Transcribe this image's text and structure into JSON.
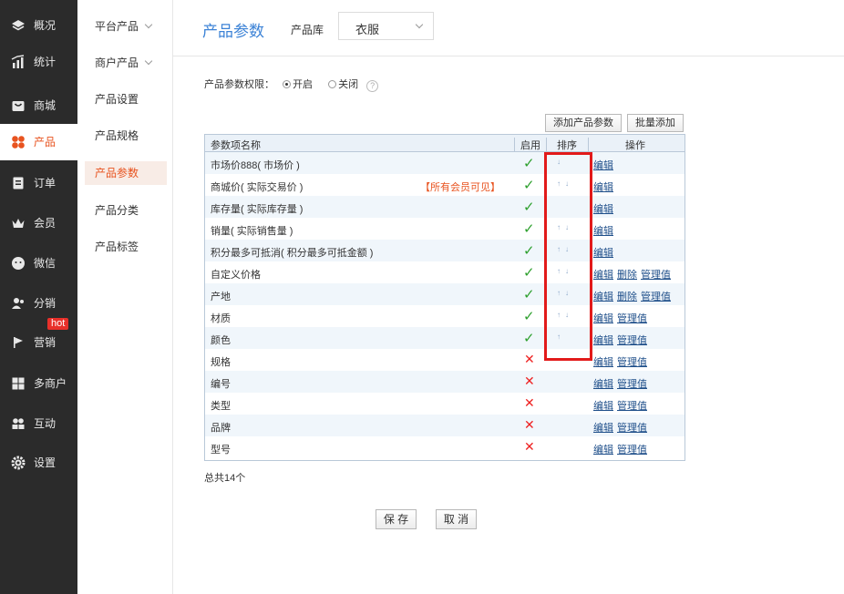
{
  "nav": {
    "items": [
      {
        "label": "概况",
        "icon": "layers-icon"
      },
      {
        "label": "统计",
        "icon": "chart-icon"
      },
      {
        "label": "商城",
        "icon": "shop-icon"
      },
      {
        "label": "产品",
        "icon": "product-icon"
      },
      {
        "label": "订单",
        "icon": "order-icon"
      },
      {
        "label": "会员",
        "icon": "crown-icon"
      },
      {
        "label": "微信",
        "icon": "wechat-icon"
      },
      {
        "label": "分销",
        "icon": "distribution-icon"
      },
      {
        "label": "营销",
        "icon": "flag-icon"
      },
      {
        "label": "多商户",
        "icon": "merchants-icon"
      },
      {
        "label": "互动",
        "icon": "interact-icon"
      },
      {
        "label": "设置",
        "icon": "gear-icon"
      }
    ],
    "hot_badge": "hot"
  },
  "submenu": {
    "items": [
      "平台产品",
      "商户产品",
      "产品设置",
      "产品规格",
      "产品参数",
      "产品分类",
      "产品标签"
    ]
  },
  "header": {
    "title": "产品参数",
    "library_label": "产品库",
    "library_value": "衣服"
  },
  "permission": {
    "label": "产品参数权限：",
    "on_label": "开启",
    "off_label": "关闭",
    "help": "?"
  },
  "toolbar": {
    "add_label": "添加产品参数",
    "batch_add_label": "批量添加"
  },
  "table": {
    "headers": {
      "name": "参数项名称",
      "enabled": "启用",
      "sort": "排序",
      "ops": "操作"
    },
    "rows": [
      {
        "name": "市场价888( 市场价 )",
        "note": "",
        "enabled": true,
        "arrows": "↓",
        "ops": [
          "编辑"
        ]
      },
      {
        "name": "商城价( 实际交易价 )",
        "note": "【所有会员可见】",
        "enabled": true,
        "arrows": "↑↓",
        "ops": [
          "编辑"
        ]
      },
      {
        "name": "库存量( 实际库存量 )",
        "note": "",
        "enabled": true,
        "arrows": "",
        "ops": [
          "编辑"
        ]
      },
      {
        "name": "销量( 实际销售量 )",
        "note": "",
        "enabled": true,
        "arrows": "↑↓",
        "ops": [
          "编辑"
        ]
      },
      {
        "name": "积分最多可抵消( 积分最多可抵金额 )",
        "note": "",
        "enabled": true,
        "arrows": "↑↓",
        "ops": [
          "编辑"
        ]
      },
      {
        "name": "自定义价格",
        "note": "",
        "enabled": true,
        "arrows": "↑↓",
        "ops": [
          "编辑",
          "删除",
          "管理值"
        ]
      },
      {
        "name": "产地",
        "note": "",
        "enabled": true,
        "arrows": "↑↓",
        "ops": [
          "编辑",
          "删除",
          "管理值"
        ]
      },
      {
        "name": "材质",
        "note": "",
        "enabled": true,
        "arrows": "↑↓",
        "ops": [
          "编辑",
          "管理值"
        ]
      },
      {
        "name": "颜色",
        "note": "",
        "enabled": true,
        "arrows": "↑",
        "ops": [
          "编辑",
          "管理值"
        ]
      },
      {
        "name": "规格",
        "note": "",
        "enabled": false,
        "arrows": "",
        "ops": [
          "编辑",
          "管理值"
        ]
      },
      {
        "name": "编号",
        "note": "",
        "enabled": false,
        "arrows": "",
        "ops": [
          "编辑",
          "管理值"
        ]
      },
      {
        "name": "类型",
        "note": "",
        "enabled": false,
        "arrows": "",
        "ops": [
          "编辑",
          "管理值"
        ]
      },
      {
        "name": "品牌",
        "note": "",
        "enabled": false,
        "arrows": "",
        "ops": [
          "编辑",
          "管理值"
        ]
      },
      {
        "name": "型号",
        "note": "",
        "enabled": false,
        "arrows": "",
        "ops": [
          "编辑",
          "管理值"
        ]
      }
    ]
  },
  "summary": {
    "total": "总共14个"
  },
  "footer": {
    "save_label": "保 存",
    "cancel_label": "取 消"
  },
  "colors": {
    "accent": "#3b82d6",
    "active": "#e8531f",
    "highlight_box": "#e21a1a"
  }
}
